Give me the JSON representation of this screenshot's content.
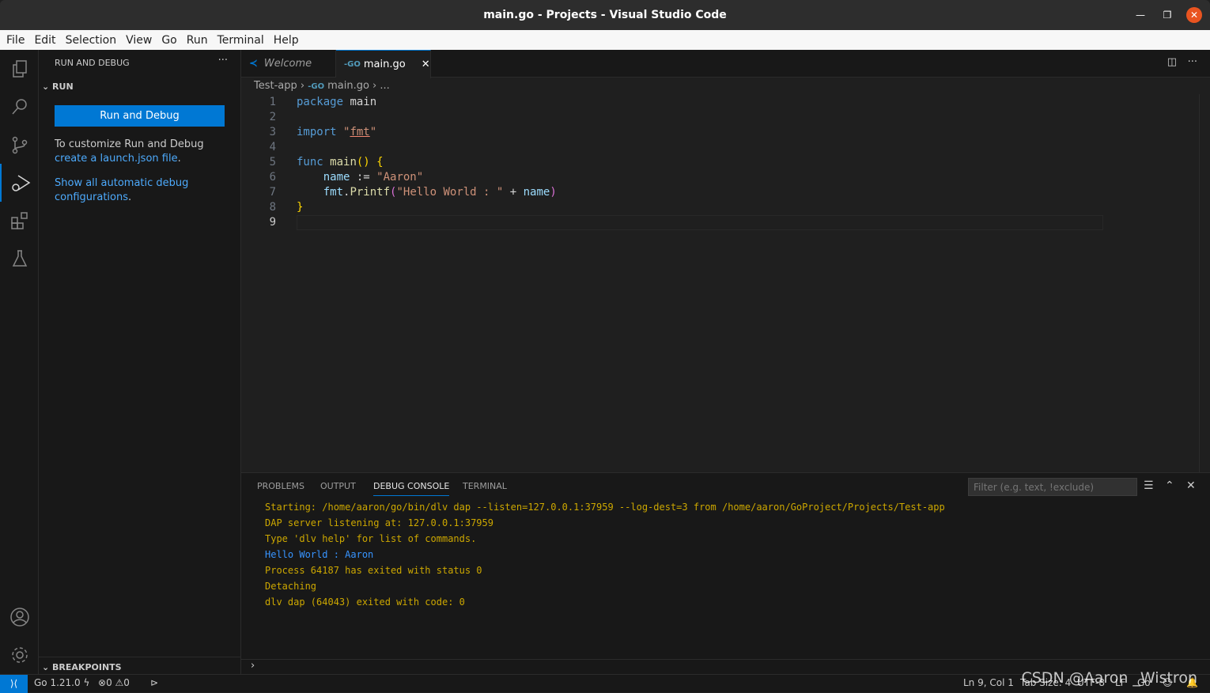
{
  "window": {
    "title": "main.go - Projects - Visual Studio Code"
  },
  "menu": [
    "File",
    "Edit",
    "Selection",
    "View",
    "Go",
    "Run",
    "Terminal",
    "Help"
  ],
  "activity": [
    "explorer-icon",
    "search-icon",
    "source-control-icon",
    "run-debug-icon",
    "extensions-icon",
    "testing-icon",
    "account-icon",
    "settings-gear-icon"
  ],
  "sidebar": {
    "title": "RUN AND DEBUG",
    "more": "···",
    "section": "RUN",
    "run_button": "Run and Debug",
    "customize_text": "To customize Run and Debug ",
    "create_link": "create a launch.json file",
    "period": ".",
    "show_all_link": "Show all automatic debug configurations",
    "breakpoints": "BREAKPOINTS"
  },
  "tabs": [
    {
      "label": "Welcome"
    },
    {
      "label": "main.go",
      "active": true
    }
  ],
  "breadcrumb": {
    "folder": "Test-app",
    "file": "main.go",
    "more": "..."
  },
  "editor": {
    "lines": [
      "1",
      "2",
      "3",
      "4",
      "5",
      "6",
      "7",
      "8",
      "9"
    ],
    "current_line": 9
  },
  "panel": {
    "tabs": [
      "PROBLEMS",
      "OUTPUT",
      "DEBUG CONSOLE",
      "TERMINAL"
    ],
    "active_tab": "DEBUG CONSOLE",
    "filter_placeholder": "Filter (e.g. text, !exclude)",
    "console": [
      "Starting: /home/aaron/go/bin/dlv dap --listen=127.0.0.1:37959 --log-dest=3 from /home/aaron/GoProject/Projects/Test-app",
      "DAP server listening at: 127.0.0.1:37959",
      "Type 'dlv help' for list of commands.",
      "Hello World : Aaron",
      "Process 64187 has exited with status 0",
      "Detaching",
      "dlv dap (64043) exited with code: 0"
    ]
  },
  "status": {
    "go_version": "Go 1.21.0",
    "errors": "0",
    "warnings": "0",
    "position": "Ln 9, Col 1",
    "tab_size": "Tab Size: 4",
    "encoding": "UTF-8",
    "eol": "LF",
    "language": "Go"
  },
  "watermark": "CSDN @Aaron _Wistron",
  "colors": {
    "accent": "#0078d4",
    "console_text": "#cca700",
    "program_output": "#3794ff",
    "close_button": "#e95420"
  }
}
